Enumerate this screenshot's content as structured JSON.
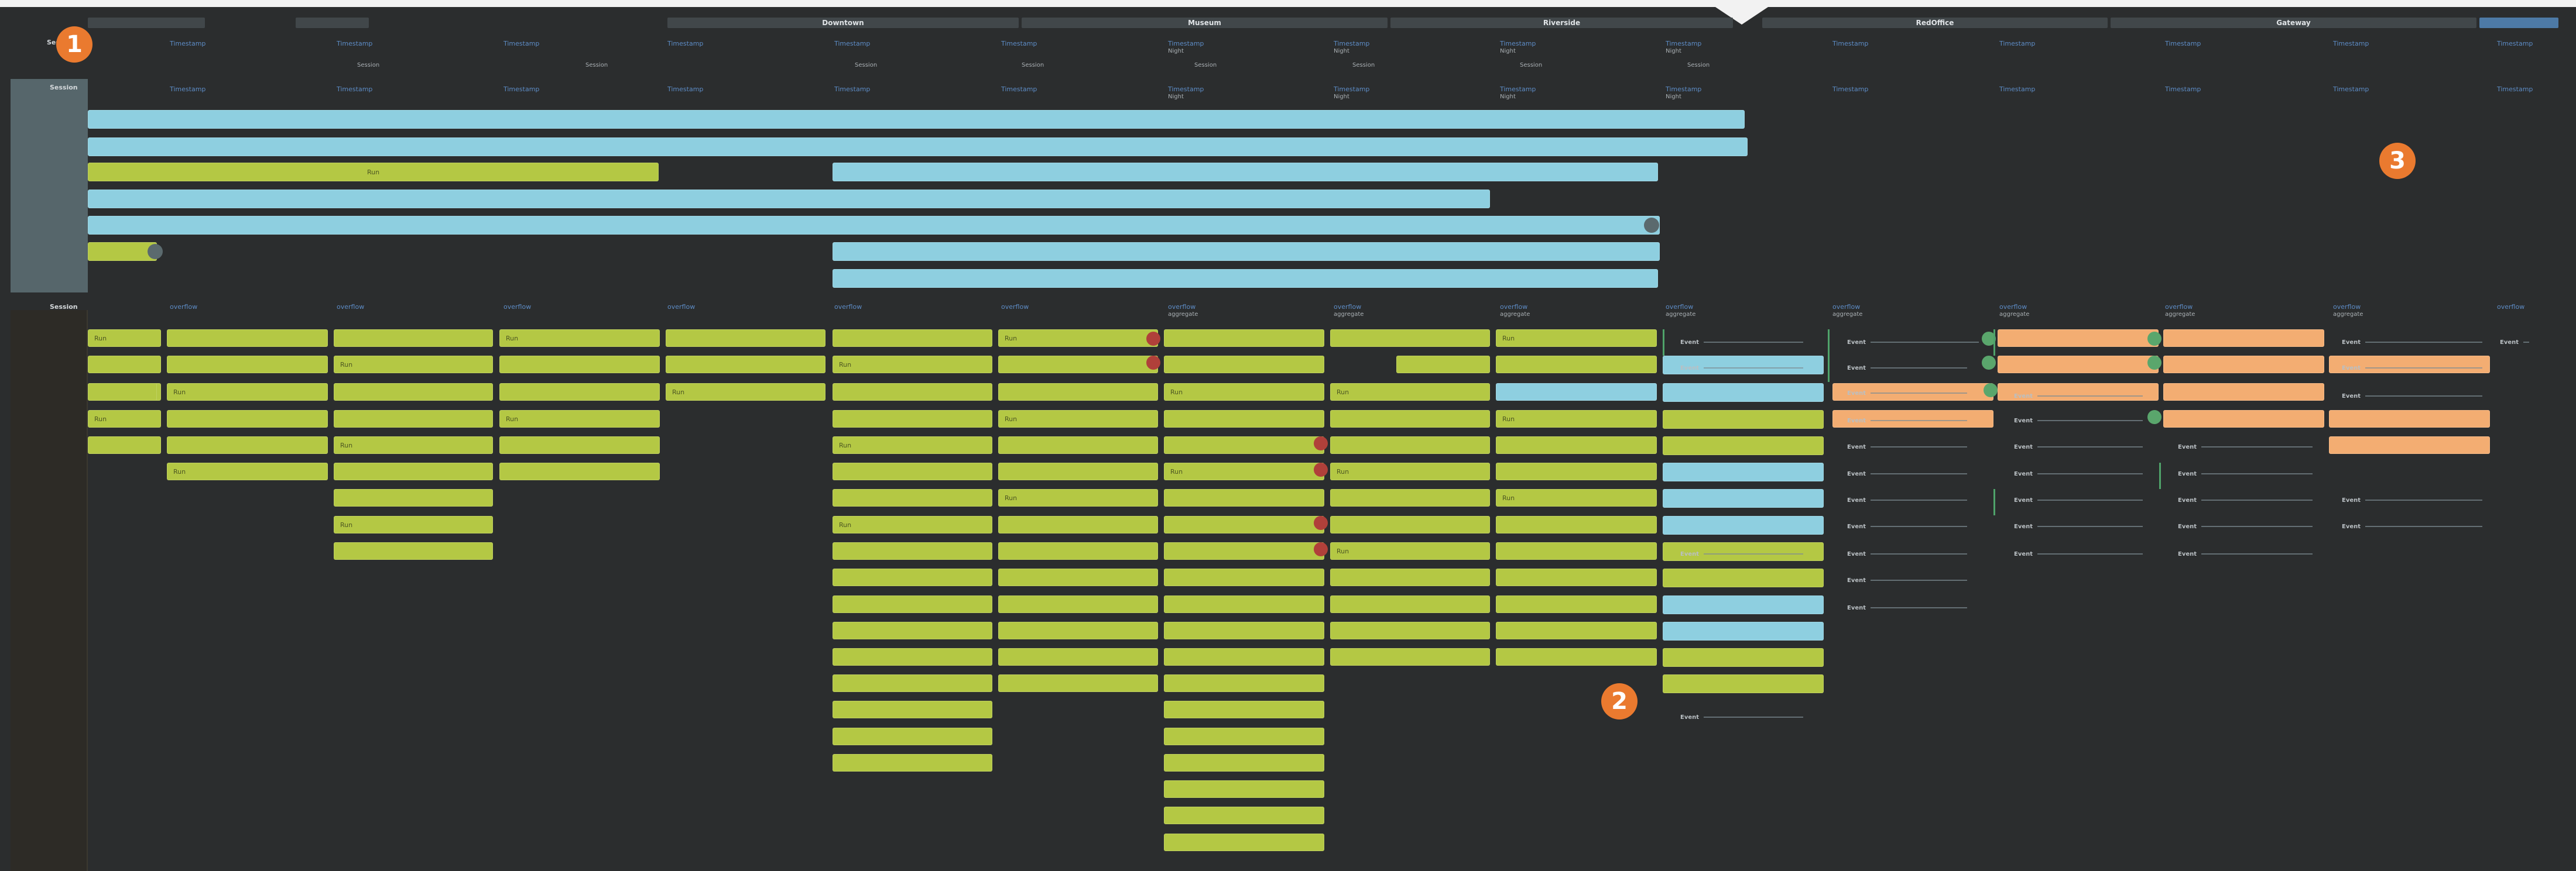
{
  "header": {
    "tabs": [
      {
        "label": ""
      },
      {
        "label": ""
      },
      {
        "label": "Downtown"
      },
      {
        "label": "Museum"
      },
      {
        "label": "Riverside"
      },
      {
        "label": "RedOffice"
      },
      {
        "label": "Gateway"
      },
      {
        "label": ""
      }
    ]
  },
  "timeline": {
    "tick_row1": [
      "Timestamp",
      "Timestamp",
      "Timestamp",
      "Timestamp",
      "Timestamp",
      "Timestamp",
      "Timestamp",
      "Timestamp",
      "Timestamp",
      "Timestamp",
      "Timestamp",
      "Timestamp",
      "Timestamp",
      "Timestamp",
      "Timestamp"
    ],
    "tick_row1_sub": [
      "Night",
      "Night",
      "Night",
      "Night"
    ],
    "tick_row2": [
      "Session",
      "Session",
      "Session",
      "Session",
      "Session",
      "Session",
      "Session",
      "Session"
    ],
    "tick_row3": [
      "Timestamp",
      "Timestamp",
      "Timestamp",
      "Timestamp",
      "Timestamp",
      "Timestamp",
      "Timestamp",
      "Timestamp",
      "Timestamp",
      "Timestamp",
      "Timestamp",
      "Timestamp",
      "Timestamp",
      "Timestamp",
      "Timestamp"
    ],
    "tick_row3_sub": [
      "Night",
      "Night",
      "Night",
      "Night"
    ],
    "tick_row4": [
      "overflow",
      "overflow",
      "overflow",
      "overflow",
      "overflow",
      "overflow",
      "overflow",
      "overflow",
      "overflow",
      "overflow",
      "overflow",
      "overflow",
      "overflow",
      "overflow",
      "overflow"
    ],
    "tick_row4_sub": [
      "aggregate",
      "aggregate",
      "aggregate",
      "aggregate",
      "aggregate",
      "aggregate",
      "aggregate",
      "aggregate"
    ]
  },
  "rows": {
    "top_label": "Session",
    "top_label_2": "Session",
    "bottom_label": "Session",
    "top_section_bar_label": "Run"
  },
  "cells": {
    "labels": [
      "Run",
      "Run",
      "Run",
      "Run",
      "Run",
      "Run",
      "Run",
      "Run",
      "Run",
      "Run",
      "Run",
      "Run",
      "Run",
      "Run",
      "Run",
      "Run",
      "Run",
      "Run",
      "Run",
      "Run",
      "Run",
      "Run",
      "Run",
      "Run"
    ]
  },
  "log_text": "Event",
  "markers": [
    {
      "number": "1"
    },
    {
      "number": "2"
    },
    {
      "number": "3"
    }
  ],
  "colors": {
    "background": "#2b2d2e",
    "blue": "#8ecfe0",
    "green": "#b4c844",
    "orange": "#f3ad72",
    "marker": "#ea7a2f"
  }
}
